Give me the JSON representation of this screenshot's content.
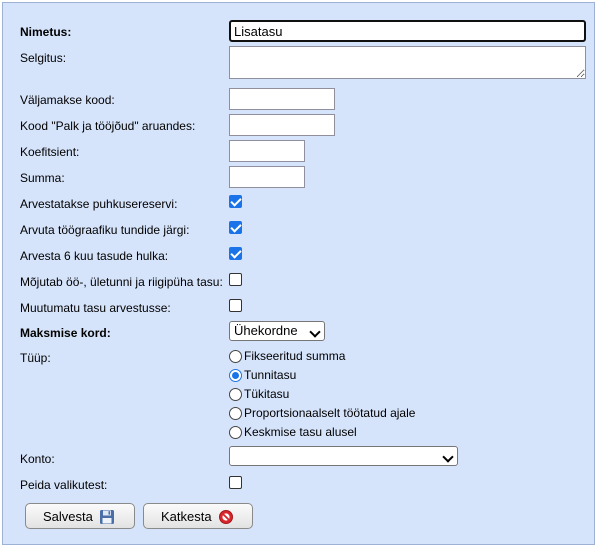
{
  "form": {
    "nimetus": {
      "label": "Nimetus:",
      "value": "Lisatasu"
    },
    "selgitus": {
      "label": "Selgitus:",
      "value": ""
    },
    "valjamakse_kood": {
      "label": "Väljamakse kood:",
      "value": ""
    },
    "kood_palk": {
      "label": "Kood \"Palk ja tööjõud\" aruandes:",
      "value": ""
    },
    "koefitsient": {
      "label": "Koefitsient:",
      "value": ""
    },
    "summa": {
      "label": "Summa:",
      "value": ""
    },
    "checkboxes": [
      {
        "label": "Arvestatakse puhkusereservi:",
        "checked": true
      },
      {
        "label": "Arvuta töögraafiku tundide järgi:",
        "checked": true
      },
      {
        "label": "Arvesta 6 kuu tasude hulka:",
        "checked": true
      },
      {
        "label": "Mõjutab öö-, ületunni ja riigipüha tasu:",
        "checked": false
      },
      {
        "label": "Muutumatu tasu arvestusse:",
        "checked": false
      }
    ],
    "maksmise_kord": {
      "label": "Maksmise kord:",
      "value": "Ühekordne"
    },
    "tyyp": {
      "label": "Tüüp:",
      "options": [
        {
          "label": "Fikseeritud summa",
          "selected": false
        },
        {
          "label": "Tunnitasu",
          "selected": true
        },
        {
          "label": "Tükitasu",
          "selected": false
        },
        {
          "label": "Proportsionaalselt töötatud ajale",
          "selected": false
        },
        {
          "label": "Keskmise tasu alusel",
          "selected": false
        }
      ]
    },
    "konto": {
      "label": "Konto:",
      "value": ""
    },
    "peida": {
      "label": "Peida valikutest:",
      "checked": false
    }
  },
  "buttons": {
    "save": {
      "label": "Salvesta",
      "icon": "floppy-disk-icon"
    },
    "cancel": {
      "label": "Katkesta",
      "icon": "cancel-icon"
    }
  },
  "colors": {
    "panel_bg": "#d6e4fb",
    "accent": "#1a73e8",
    "cancel_red": "#d9262c"
  }
}
